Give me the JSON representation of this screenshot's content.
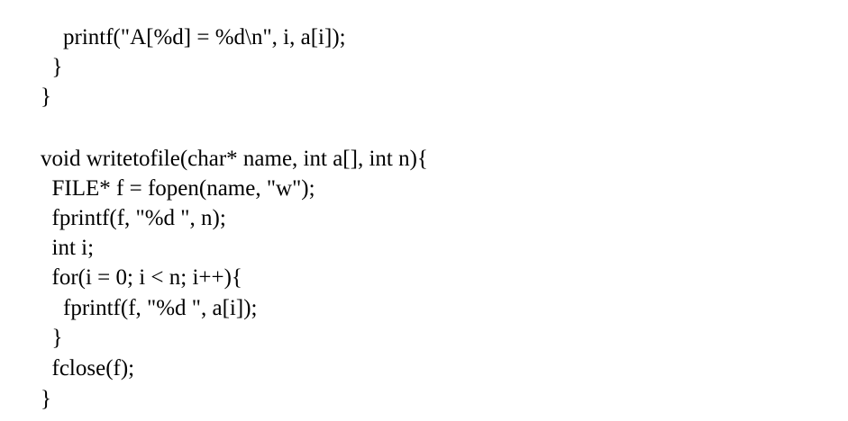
{
  "document": {
    "lines": [
      "    printf(\"A[%d] = %d\\n\", i, a[i]);",
      "  }",
      "}",
      "",
      "void writetofile(char* name, int a[], int n){",
      "  FILE* f = fopen(name, \"w\");",
      "  fprintf(f, \"%d \", n);",
      "  int i;",
      "  for(i = 0; i < n; i++){",
      "    fprintf(f, \"%d \", a[i]);",
      "  }",
      "  fclose(f);",
      "}"
    ]
  }
}
